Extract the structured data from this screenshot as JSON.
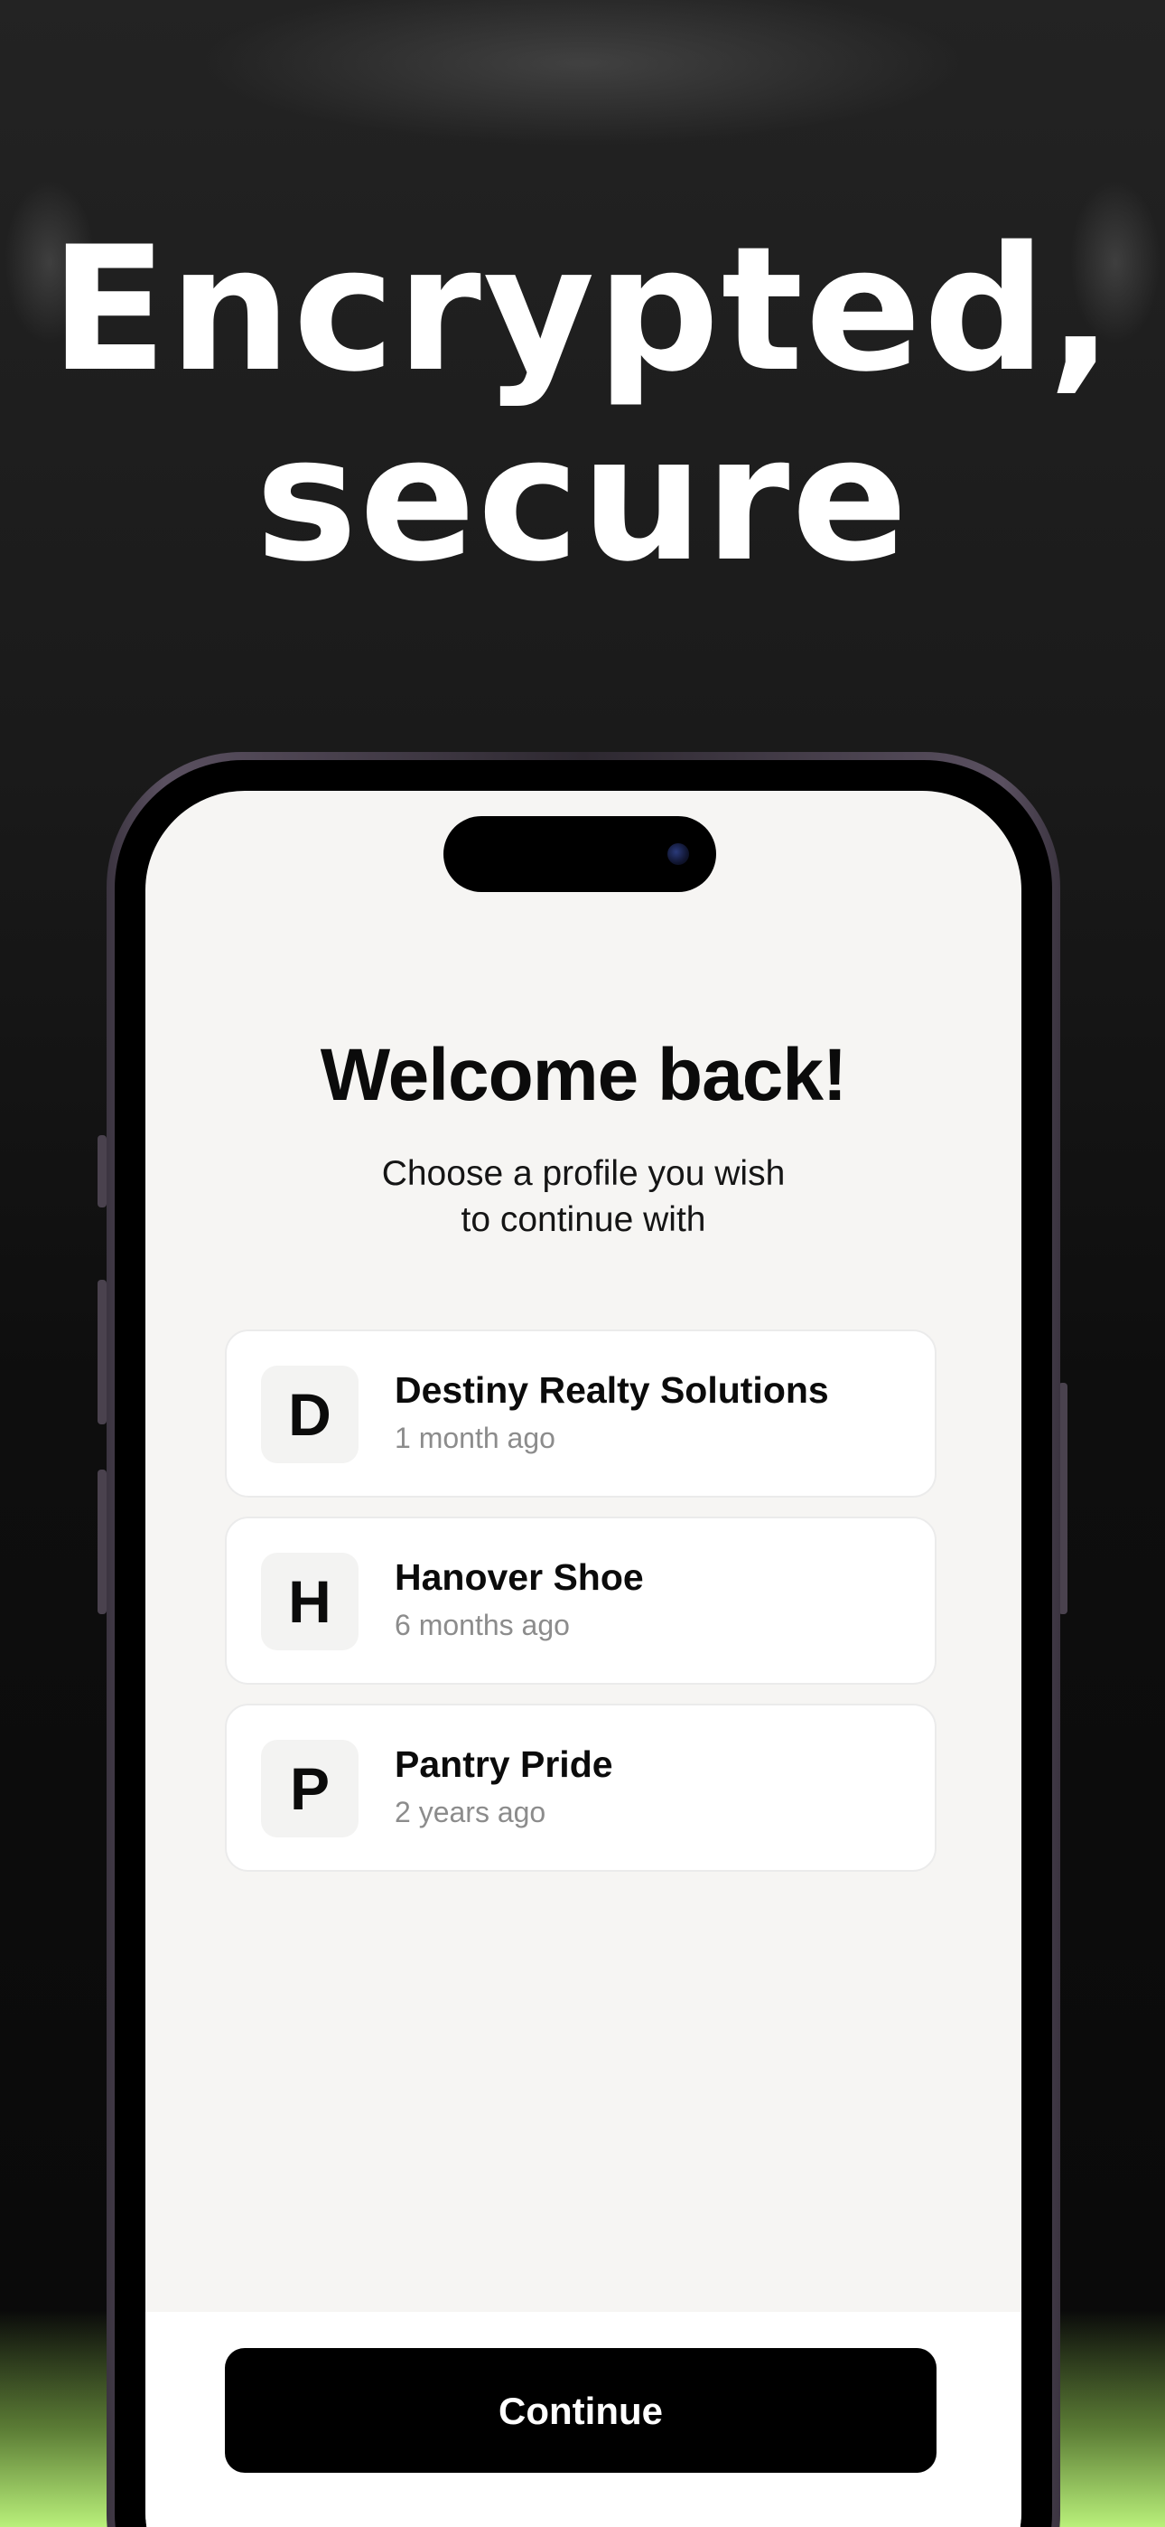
{
  "headline": {
    "line1": "Encrypted,",
    "line2": "secure"
  },
  "screen": {
    "title": "Welcome back!",
    "subtitle": "Choose a profile you wish\nto continue with",
    "profiles": [
      {
        "initial": "D",
        "name": "Destiny Realty Solutions",
        "time": "1 month ago"
      },
      {
        "initial": "H",
        "name": "Hanover Shoe",
        "time": "6 months ago"
      },
      {
        "initial": "P",
        "name": "Pantry Pride",
        "time": "2 years ago"
      }
    ],
    "continue_label": "Continue"
  },
  "colors": {
    "accent_glow": "#b9f07a",
    "button_bg": "#000000",
    "screen_bg": "#f6f5f3"
  }
}
